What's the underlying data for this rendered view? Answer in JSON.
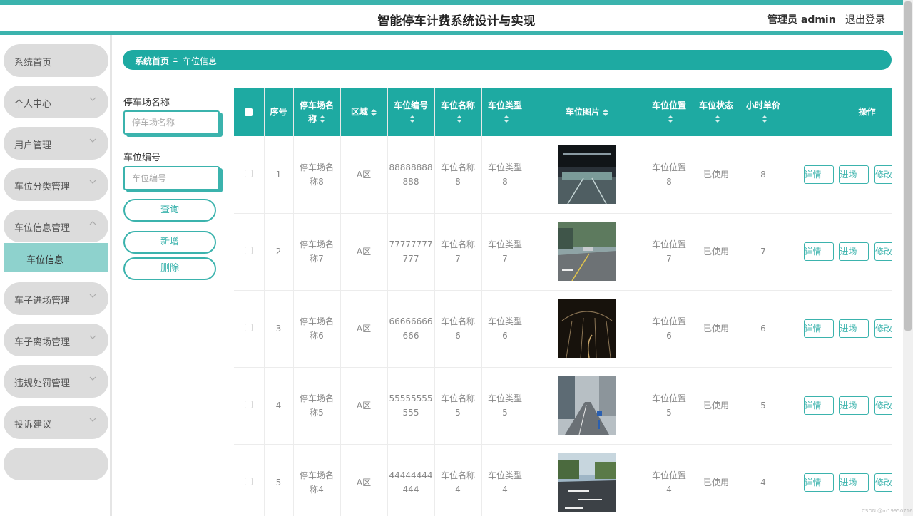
{
  "header": {
    "title": "智能停车计费系统设计与实现",
    "admin": "管理员 admin",
    "logout": "退出登录"
  },
  "sidebar": {
    "items": [
      {
        "label": "系统首页"
      },
      {
        "label": "个人中心"
      },
      {
        "label": "用户管理"
      },
      {
        "label": "车位分类管理"
      },
      {
        "label": "车位信息管理"
      },
      {
        "label": "车子进场管理"
      },
      {
        "label": "车子离场管理"
      },
      {
        "label": "违规处罚管理"
      },
      {
        "label": "投诉建议"
      }
    ],
    "active_sub": "车位信息"
  },
  "breadcrumb": {
    "home": "系统首页",
    "sep": "Ξ",
    "current": "车位信息"
  },
  "search": {
    "name_label": "停车场名称",
    "name_placeholder": "停车场名称",
    "code_label": "车位编号",
    "code_placeholder": "车位编号",
    "query": "查询",
    "add": "新增",
    "delete": "删除"
  },
  "table": {
    "headers": {
      "seq": "序号",
      "lot_a": "停车场名",
      "lot_b": "称",
      "area": "区域",
      "code": "车位编号",
      "name": "车位名称",
      "type": "车位类型",
      "image": "车位图片",
      "position": "车位位置",
      "status": "车位状态",
      "price": "小时单价",
      "ops": "操作"
    },
    "rows": [
      {
        "seq": "1",
        "lot_a": "停车场名",
        "lot_b": "称8",
        "area": "A区",
        "code_a": "88888888",
        "code_b": "888",
        "name_a": "车位名称",
        "name_b": "8",
        "type_a": "车位类型",
        "type_b": "8",
        "pos_a": "车位位置",
        "pos_b": "8",
        "status": "已使用",
        "price": "8"
      },
      {
        "seq": "2",
        "lot_a": "停车场名",
        "lot_b": "称7",
        "area": "A区",
        "code_a": "77777777",
        "code_b": "777",
        "name_a": "车位名称",
        "name_b": "7",
        "type_a": "车位类型",
        "type_b": "7",
        "pos_a": "车位位置",
        "pos_b": "7",
        "status": "已使用",
        "price": "7"
      },
      {
        "seq": "3",
        "lot_a": "停车场名",
        "lot_b": "称6",
        "area": "A区",
        "code_a": "66666666",
        "code_b": "666",
        "name_a": "车位名称",
        "name_b": "6",
        "type_a": "车位类型",
        "type_b": "6",
        "pos_a": "车位位置",
        "pos_b": "6",
        "status": "已使用",
        "price": "6"
      },
      {
        "seq": "4",
        "lot_a": "停车场名",
        "lot_b": "称5",
        "area": "A区",
        "code_a": "55555555",
        "code_b": "555",
        "name_a": "车位名称",
        "name_b": "5",
        "type_a": "车位类型",
        "type_b": "5",
        "pos_a": "车位位置",
        "pos_b": "5",
        "status": "已使用",
        "price": "5"
      },
      {
        "seq": "5",
        "lot_a": "停车场名",
        "lot_b": "称4",
        "area": "A区",
        "code_a": "44444444",
        "code_b": "444",
        "name_a": "车位名称",
        "name_b": "4",
        "type_a": "车位类型",
        "type_b": "4",
        "pos_a": "车位位置",
        "pos_b": "4",
        "status": "已使用",
        "price": "4"
      }
    ],
    "actions": {
      "detail": "详情",
      "enter": "进场",
      "edit": "修改"
    }
  },
  "watermark": "CSDN @m19950716"
}
